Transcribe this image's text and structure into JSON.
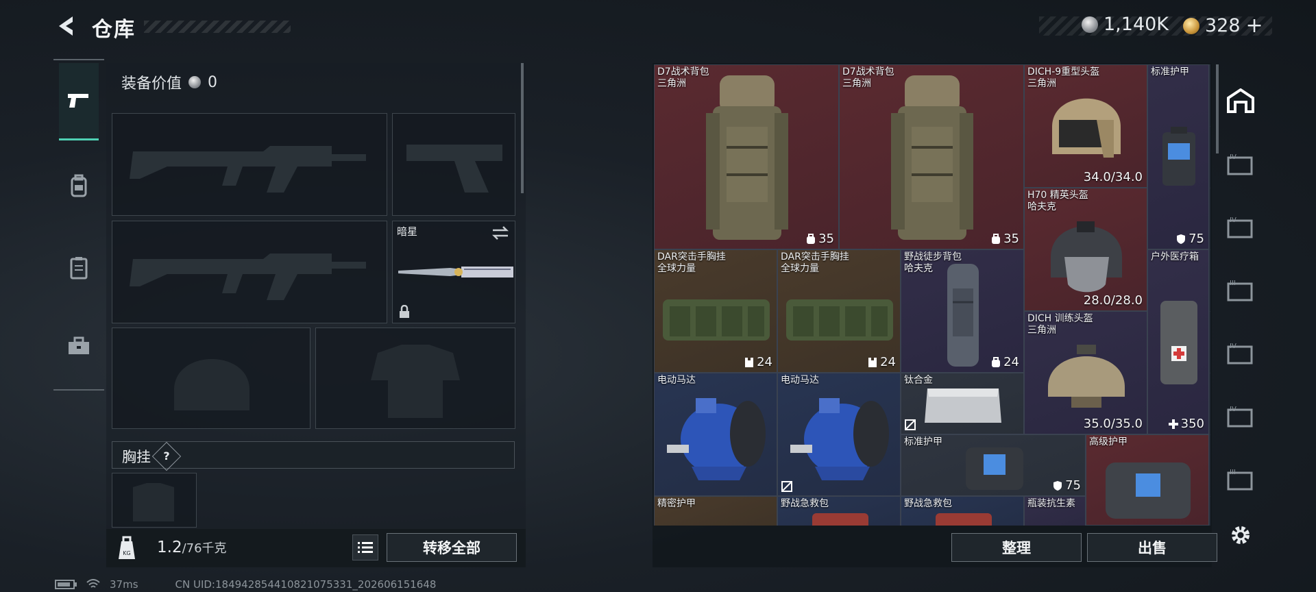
{
  "header": {
    "title": "仓库"
  },
  "currency": {
    "silver": "1,140K",
    "gold": "328",
    "gold_plus": "+"
  },
  "left_panel": {
    "equipment_value_label": "装备价值",
    "equipment_value": "0",
    "melee_name": "暗星",
    "chest_rig_label": "胸挂",
    "chest_rig_help": "?",
    "weight_current": "1.2",
    "weight_max": "/76千克",
    "transfer_all": "转移全部"
  },
  "left_nav": [
    "weapons",
    "backpack",
    "armor",
    "toolbox"
  ],
  "stash": {
    "items": [
      {
        "name": "D7战术背包",
        "sub": "三角洲",
        "value": "35",
        "value_icon": "bag"
      },
      {
        "name": "D7战术背包",
        "sub": "三角洲",
        "value": "35",
        "value_icon": "bag"
      },
      {
        "name": "DICH-9重型头盔",
        "sub": "三角洲",
        "value": "34.0/34.0"
      },
      {
        "name": "标准护甲",
        "sub": "",
        "value": "75",
        "value_icon": "shield"
      },
      {
        "name": "H70 精英头盔",
        "sub": "哈夫克",
        "value": "28.0/28.0"
      },
      {
        "name": "DAR突击手胸挂",
        "sub": "全球力量",
        "value": "24",
        "value_icon": "rig"
      },
      {
        "name": "DAR突击手胸挂",
        "sub": "全球力量",
        "value": "24",
        "value_icon": "rig"
      },
      {
        "name": "野战徒步背包",
        "sub": "哈夫克",
        "value": "24",
        "value_icon": "bag"
      },
      {
        "name": "户外医疗箱",
        "sub": "",
        "value": "350",
        "value_icon": "plus"
      },
      {
        "name": "DICH 训练头盔",
        "sub": "三角洲",
        "value": "35.0/35.0"
      },
      {
        "name": "电动马达",
        "sub": "",
        "value": ""
      },
      {
        "name": "电动马达",
        "sub": "",
        "value": ""
      },
      {
        "name": "钛合金",
        "sub": "",
        "value": ""
      },
      {
        "name": "标准护甲",
        "sub": "",
        "value": "75",
        "value_icon": "shield"
      },
      {
        "name": "高级护甲",
        "sub": "",
        "value": ""
      },
      {
        "name": "精密护甲",
        "sub": "",
        "value": ""
      },
      {
        "name": "野战急救包",
        "sub": "",
        "value": ""
      },
      {
        "name": "野战急救包",
        "sub": "",
        "value": ""
      },
      {
        "name": "瓶装抗生素",
        "sub": "",
        "value": ""
      }
    ],
    "sort_button": "整理",
    "sell_button": "出售"
  },
  "status_bar": {
    "ping": "37ms",
    "uid": "CN UID:184942854410821075331_202606151648"
  },
  "colors": {
    "accent": "#4fd1b4",
    "red_rarity": "#5a2a30",
    "purple_rarity": "#322e48",
    "blue_rarity": "#283552",
    "gold_rarity": "#4a3b2c"
  }
}
